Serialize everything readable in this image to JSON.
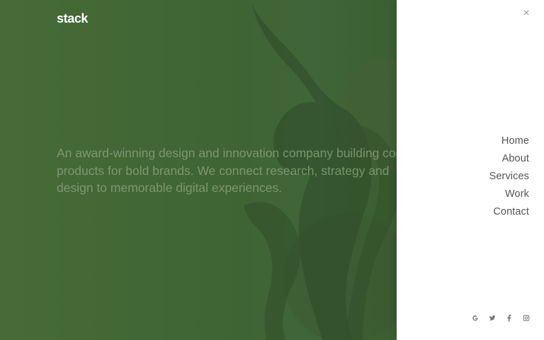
{
  "brand": {
    "logo": "stack"
  },
  "hero": {
    "tagline": "An award-winning design and innovation company building cool products for bold brands. We connect research, strategy and design to memorable digital experiences."
  },
  "drawer": {
    "close_icon": "×",
    "nav_items": [
      {
        "label": "Home"
      },
      {
        "label": "About"
      },
      {
        "label": "Services"
      },
      {
        "label": "Work"
      },
      {
        "label": "Contact"
      }
    ],
    "social": [
      {
        "icon": "google-icon"
      },
      {
        "icon": "twitter-icon"
      },
      {
        "icon": "facebook-icon"
      },
      {
        "icon": "instagram-icon"
      }
    ]
  }
}
